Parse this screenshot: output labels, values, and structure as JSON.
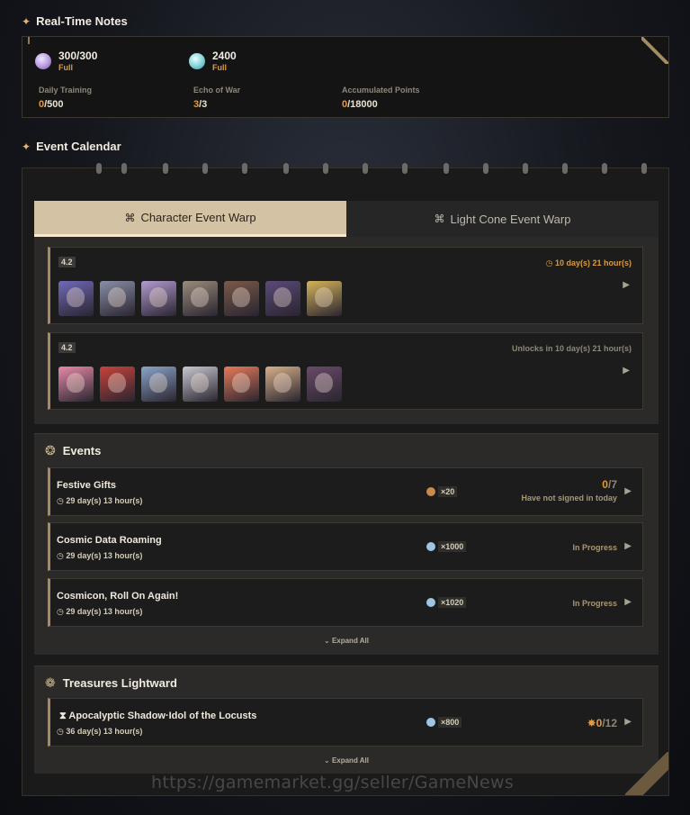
{
  "notes": {
    "title": "Real-Time Notes",
    "resources": [
      {
        "value": "300/300",
        "status": "Full",
        "icon": "trailblaze-power-icon"
      },
      {
        "value": "2400",
        "status": "Full",
        "icon": "reserved-power-icon"
      }
    ],
    "stats": [
      {
        "label": "Daily Training",
        "current": "0",
        "total": "/500"
      },
      {
        "label": "Echo of War",
        "current": "3",
        "total": "/3"
      },
      {
        "label": "Accumulated Points",
        "current": "0",
        "total": "/18000"
      }
    ]
  },
  "calendar": {
    "title": "Event Calendar",
    "tabs": [
      {
        "label": "Character Event Warp",
        "active": true
      },
      {
        "label": "Light Cone Event Warp",
        "active": false
      }
    ],
    "warps": [
      {
        "version": "4.2",
        "time": "10 day(s) 21 hour(s)",
        "avatar_colors": [
          "#6f6ab8",
          "#8a8fa8",
          "#b29ad0",
          "#9a8c7c",
          "#7a5a4a",
          "#5a4a78",
          "#d6b45a"
        ]
      },
      {
        "version": "4.2",
        "time": "Unlocks in 10 day(s) 21 hour(s)",
        "avatar_colors": [
          "#e88aa8",
          "#c8423a",
          "#8aa4c8",
          "#c8c8d0",
          "#e87a5a",
          "#d8b08a",
          "#6a4a6a"
        ]
      }
    ],
    "events": {
      "title": "Events",
      "items": [
        {
          "name": "Festive Gifts",
          "time": "29 day(s) 13 hour(s)",
          "reward": "×20",
          "count_current": "0",
          "count_total": "/7",
          "sub": "Have not signed in today"
        },
        {
          "name": "Cosmic Data Roaming",
          "time": "29 day(s) 13 hour(s)",
          "reward": "×1000",
          "status": "In Progress"
        },
        {
          "name": "Cosmicon, Roll On Again!",
          "time": "29 day(s) 13 hour(s)",
          "reward": "×1020",
          "status": "In Progress"
        }
      ],
      "expand": "Expand All"
    },
    "treasures": {
      "title": "Treasures Lightward",
      "items": [
        {
          "name": "Apocalyptic Shadow·Idol of the Locusts",
          "time": "36 day(s) 13 hour(s)",
          "reward": "×800",
          "count_current": "0",
          "count_total": "/12"
        }
      ],
      "expand": "Expand All"
    }
  },
  "watermark": "https://gamemarket.gg/seller/GameNews",
  "colors": {
    "accent": "#e09a3f",
    "tab_active": "#d3c2a3",
    "panel": "#2b2a28"
  }
}
